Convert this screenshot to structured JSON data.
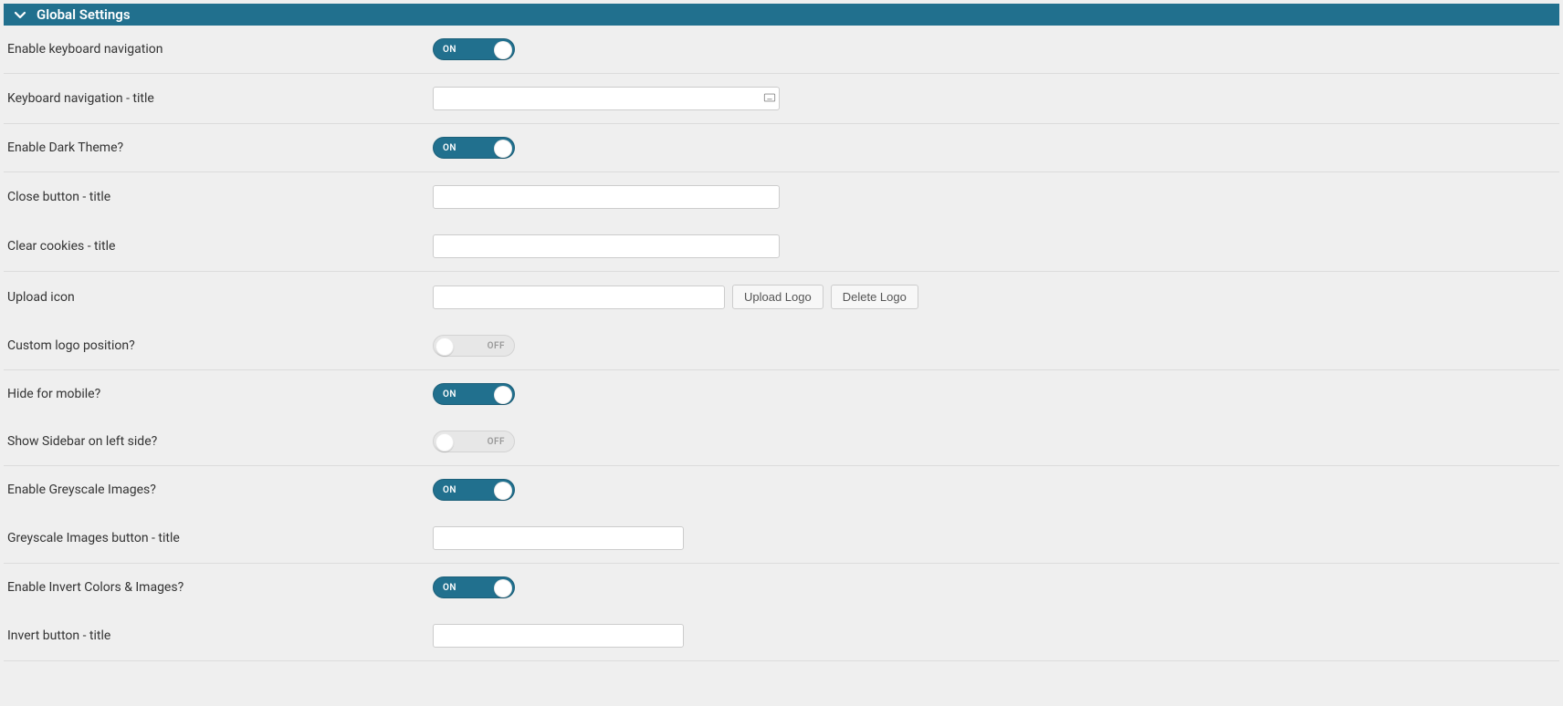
{
  "header": {
    "title": "Global Settings"
  },
  "toggle_labels": {
    "on": "ON",
    "off": "OFF"
  },
  "buttons": {
    "upload_logo": "Upload Logo",
    "delete_logo": "Delete Logo"
  },
  "rows": {
    "enable_keyboard_nav": {
      "label": "Enable keyboard navigation",
      "state": "on"
    },
    "keyboard_nav_title": {
      "label": "Keyboard navigation - title",
      "value": ""
    },
    "enable_dark_theme": {
      "label": "Enable Dark Theme?",
      "state": "on"
    },
    "close_button_title": {
      "label": "Close button - title",
      "value": ""
    },
    "clear_cookies_title": {
      "label": "Clear cookies - title",
      "value": ""
    },
    "upload_icon": {
      "label": "Upload icon",
      "value": ""
    },
    "custom_logo_position": {
      "label": "Custom logo position?",
      "state": "off"
    },
    "hide_for_mobile": {
      "label": "Hide for mobile?",
      "state": "on"
    },
    "show_sidebar_left": {
      "label": "Show Sidebar on left side?",
      "state": "off"
    },
    "enable_greyscale": {
      "label": "Enable Greyscale Images?",
      "state": "on"
    },
    "greyscale_title": {
      "label": "Greyscale Images button - title",
      "value": ""
    },
    "enable_invert": {
      "label": "Enable Invert Colors & Images?",
      "state": "on"
    },
    "invert_title": {
      "label": "Invert button - title",
      "value": ""
    }
  }
}
